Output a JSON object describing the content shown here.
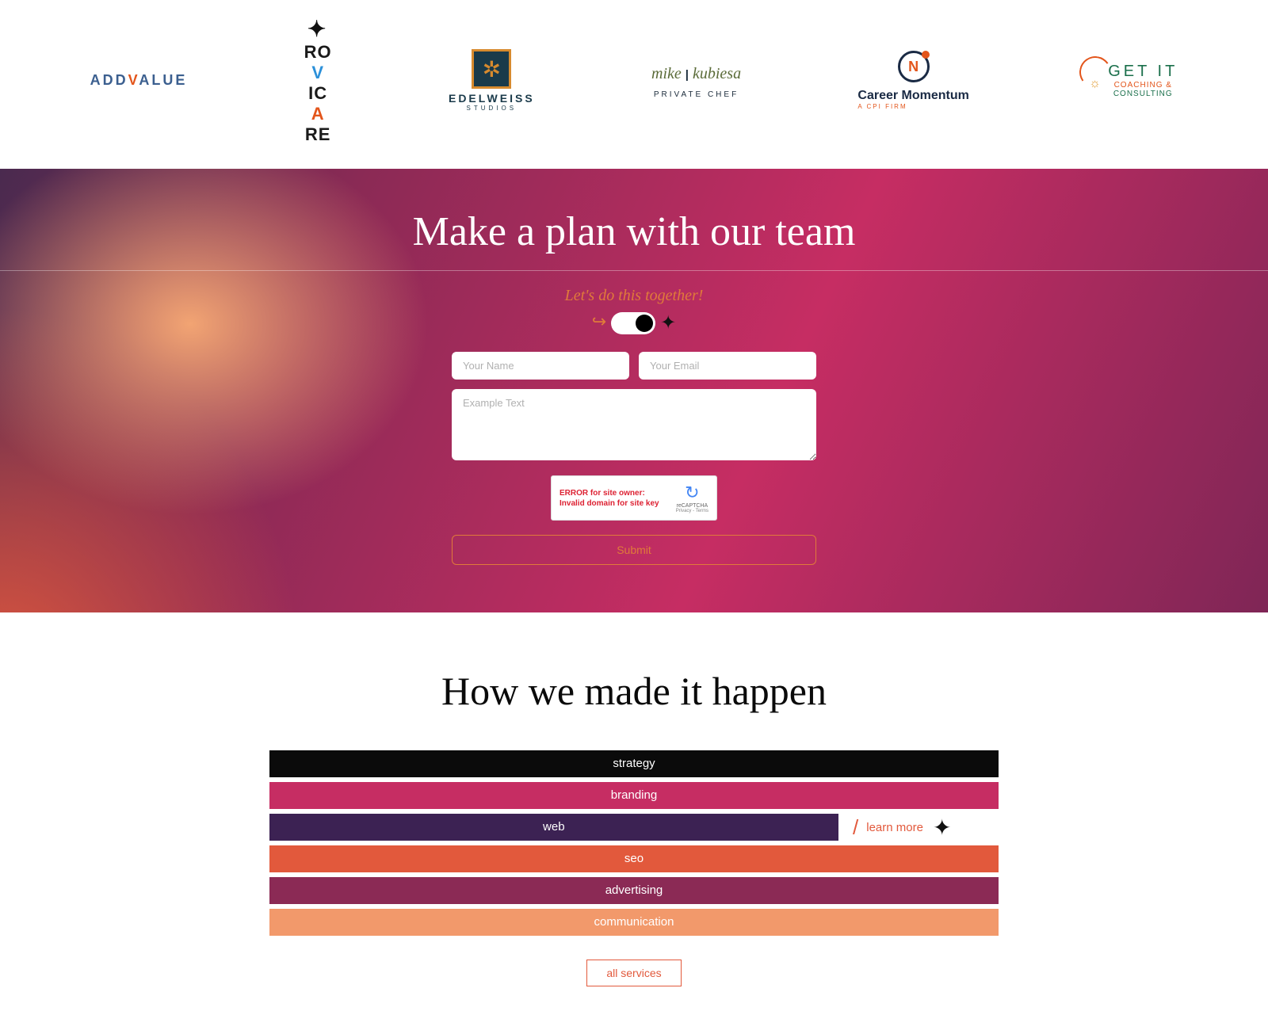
{
  "logos": {
    "addvalue": "ADDVALUE",
    "rovicare": "ROVICARE",
    "edelweiss_name": "EDELWEISS",
    "edelweiss_sub": "STUDIOS",
    "kubiesa_main": "mike | kubiesa",
    "kubiesa_sub": "PRIVATE CHEF",
    "career_text": "Career Momentum",
    "career_sub": "A CPI FIRM",
    "getit_main": "GET IT",
    "getit_sub": "COACHING &",
    "getit_sub2": "CONSULTING"
  },
  "hero": {
    "title": "Make a plan with our team",
    "sub": "Let's do this together!",
    "name_placeholder": "Your Name",
    "email_placeholder": "Your Email",
    "message_placeholder": "Example Text",
    "submit": "Submit",
    "recaptcha_error_line1": "ERROR for site owner:",
    "recaptcha_error_line2": "Invalid domain for site key",
    "recaptcha_label": "reCAPTCHA",
    "recaptcha_terms": "Privacy - Terms"
  },
  "services": {
    "title": "How we made it happen",
    "items": [
      "strategy",
      "branding",
      "web",
      "seo",
      "advertising",
      "communication"
    ],
    "learn_more": "learn more",
    "all_btn": "all services"
  }
}
